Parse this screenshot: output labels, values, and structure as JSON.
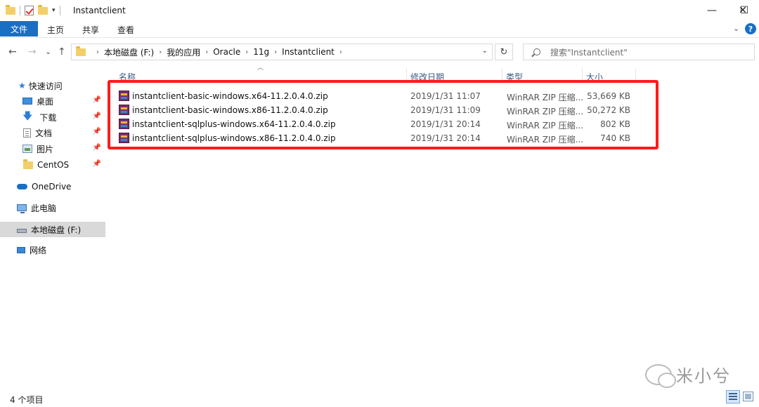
{
  "window": {
    "title": "Instantclient",
    "minimize": "—",
    "maximize": "☐",
    "close": "✕"
  },
  "ribbon": {
    "file": "文件",
    "home": "主页",
    "share": "共享",
    "view": "查看",
    "expand": "⌄",
    "help": "?"
  },
  "nav": {
    "back": "←",
    "forward": "→",
    "recent": "⌄",
    "up": "↑",
    "refresh": "↻",
    "breadcrumb": [
      "本地磁盘 (F:)",
      "我的应用",
      "Oracle",
      "11g",
      "Instantclient"
    ],
    "search_placeholder": "搜索\"Instantclient\""
  },
  "sidebar": {
    "quick_access": "快速访问",
    "items": [
      {
        "label": "桌面",
        "icon": "desktop-icon"
      },
      {
        "label": "下载",
        "icon": "download-icon"
      },
      {
        "label": "文档",
        "icon": "document-icon"
      },
      {
        "label": "图片",
        "icon": "picture-icon"
      },
      {
        "label": "CentOS",
        "icon": "folder-icon"
      }
    ],
    "onedrive": "OneDrive",
    "this_pc": "此电脑",
    "drive": "本地磁盘 (F:)",
    "network": "网络"
  },
  "columns": {
    "name": "名称",
    "modified": "修改日期",
    "type": "类型",
    "size": "大小"
  },
  "files": [
    {
      "name": "instantclient-basic-windows.x64-11.2.0.4.0.zip",
      "modified": "2019/1/31 11:07",
      "type": "WinRAR ZIP 压缩...",
      "size": "53,669 KB"
    },
    {
      "name": "instantclient-basic-windows.x86-11.2.0.4.0.zip",
      "modified": "2019/1/31 11:09",
      "type": "WinRAR ZIP 压缩...",
      "size": "50,272 KB"
    },
    {
      "name": "instantclient-sqlplus-windows.x64-11.2.0.4.0.zip",
      "modified": "2019/1/31 20:14",
      "type": "WinRAR ZIP 压缩...",
      "size": "802 KB"
    },
    {
      "name": "instantclient-sqlplus-windows.x86-11.2.0.4.0.zip",
      "modified": "2019/1/31 20:14",
      "type": "WinRAR ZIP 压缩...",
      "size": "740 KB"
    }
  ],
  "status": {
    "count": "4 个项目"
  },
  "watermark": "米小兮",
  "colors": {
    "accent": "#1a6fc4",
    "highlight_box": "#ff1a1a",
    "selected_bg": "#d9d9d9"
  }
}
